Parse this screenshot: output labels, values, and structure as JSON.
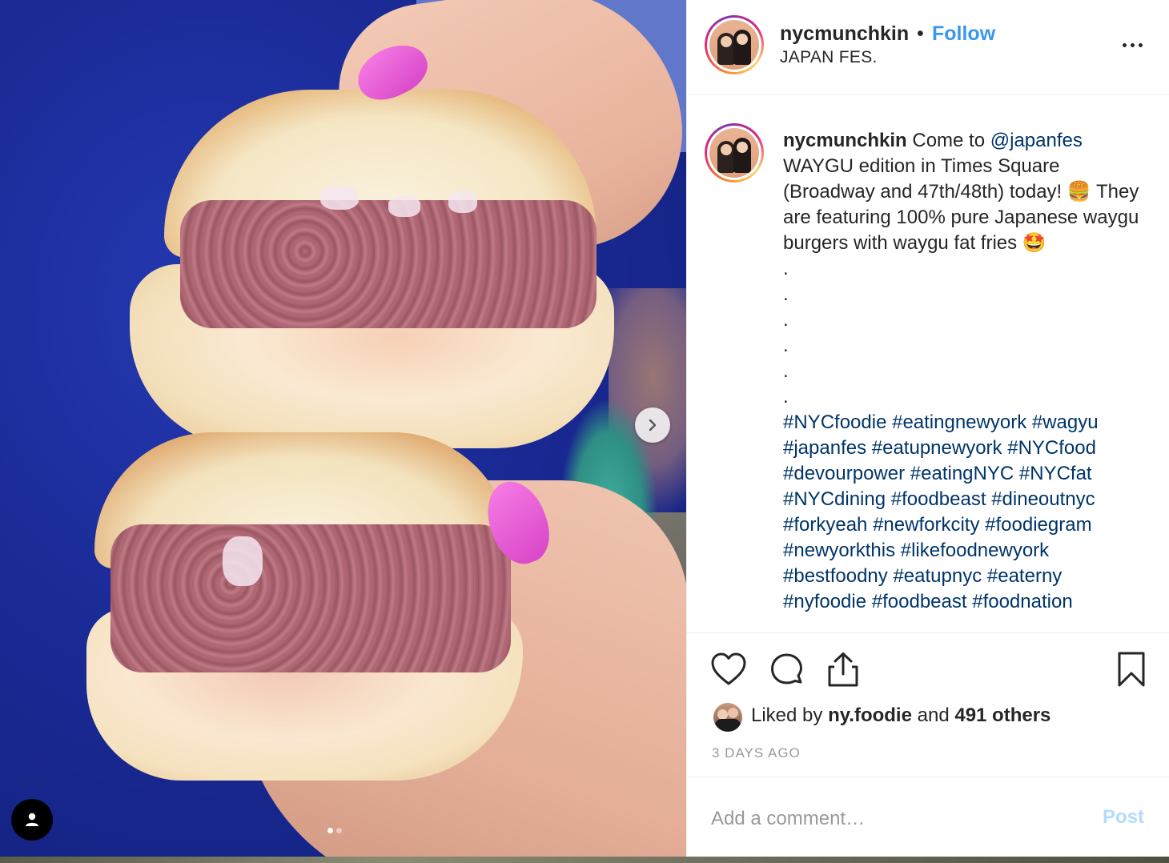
{
  "post": {
    "username": "nycmunchkin",
    "separator": "•",
    "follow_label": "Follow",
    "location": "JAPAN FES.",
    "more_icon": "more-horizontal-icon"
  },
  "caption": {
    "username": "nycmunchkin",
    "text_before_mention": " Come to ",
    "mention": "@japanfes",
    "text_after_mention": " WAYGU edition in Times Square (Broadway and 47th/48th) today! 🍔 They are featuring 100% pure Japanese waygu burgers with waygu fat fries 🤩",
    "dots": [
      ".",
      ".",
      ".",
      ".",
      ".",
      "."
    ],
    "hashtags": [
      "#NYCfoodie",
      "#eatingnewyork",
      "#wagyu",
      "#japanfes",
      "#eatupnewyork",
      "#NYCfood",
      "#devourpower",
      "#eatingNYC",
      "#NYCfat",
      "#NYCdining",
      "#foodbeast",
      "#dineoutnyc",
      "#forkyeah",
      "#newforkcity",
      "#foodiegram",
      "#newyorkthis",
      "#likefoodnewyork",
      "#bestfoodny",
      "#eatupnyc",
      "#eaterny",
      "#nyfoodie",
      "#foodbeast",
      "#foodnation"
    ]
  },
  "actions": {
    "like_icon": "heart-icon",
    "comment_icon": "comment-icon",
    "share_icon": "share-icon",
    "save_icon": "bookmark-icon"
  },
  "likes": {
    "prefix": "Liked by ",
    "liker": "ny.foodie",
    "middle": " and ",
    "others": "491 others"
  },
  "timestamp": "3 DAYS AGO",
  "comment": {
    "placeholder": "Add a comment…",
    "post_label": "Post"
  },
  "carousel": {
    "total_slides": 2,
    "current_slide": 1
  },
  "colors": {
    "link_blue": "#3897f0",
    "hashtag_navy": "#003569",
    "post_disabled": "#b3dbff",
    "muted_gray": "#999999",
    "text": "#262626"
  }
}
